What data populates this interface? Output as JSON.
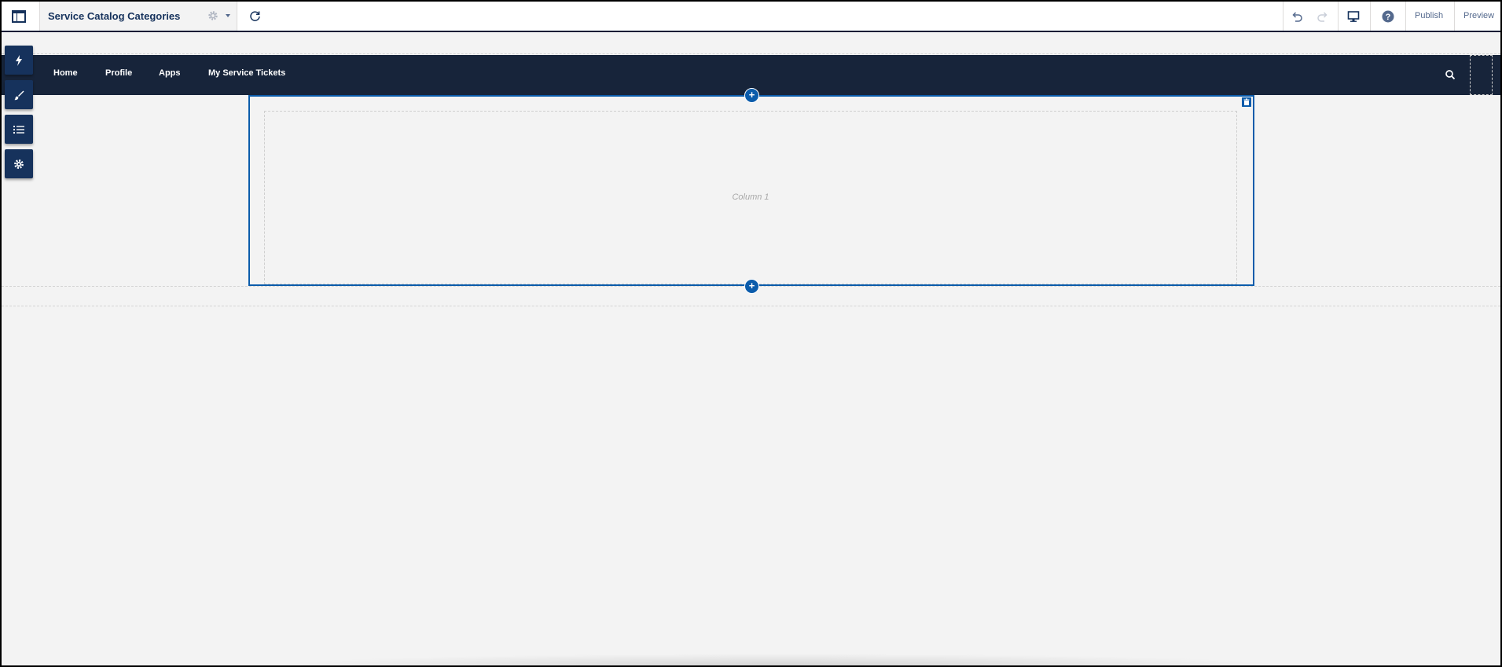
{
  "toolbar": {
    "page_title": "Service Catalog Categories",
    "publish_label": "Publish",
    "preview_label": "Preview",
    "icons": [
      "app-layout-icon",
      "gear-icon",
      "chevron-down-icon",
      "refresh-icon",
      "undo-icon",
      "redo-icon",
      "desktop-icon",
      "help-icon"
    ]
  },
  "palette": {
    "icons": [
      "lightning-icon",
      "paintbrush-icon",
      "list-icon",
      "gear-icon"
    ]
  },
  "nav": {
    "items": [
      "Home",
      "Profile",
      "Apps",
      "My Service Tickets"
    ],
    "search_icon": "search-icon"
  },
  "section": {
    "column_label": "Column 1",
    "add_label": "+",
    "delete_icon": "trash-icon"
  },
  "colors": {
    "brand_navy": "#16325c",
    "nav_bg": "#17243a",
    "selection_blue": "#0b5cab",
    "canvas_bg": "#f3f3f3"
  }
}
